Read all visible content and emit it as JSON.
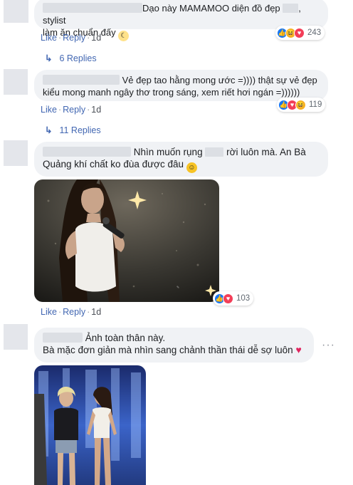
{
  "comments": [
    {
      "text_a": "Dạo này MAMAMOO diện đồ đẹp",
      "text_b": ", stylist",
      "text_c": "làm ăn chuẩn đấy",
      "emoji": "crescent-moon",
      "actions": {
        "like": "Like",
        "reply": "Reply",
        "time": "1d"
      },
      "reaction_count": "243",
      "replies": "6 Replies"
    },
    {
      "text_a": "Vẻ đẹp tao hằng mong ước =)))) thật sự vẻ đẹp",
      "text_b": "kiểu mong manh ngây thơ trong sáng, xem riết hơi ngán =))))))",
      "actions": {
        "like": "Like",
        "reply": "Reply",
        "time": "1d"
      },
      "reaction_count": "119",
      "replies": "11 Replies"
    },
    {
      "text_a": "Nhìn muốn rụng",
      "text_b": "rời luôn mà. An Bà",
      "text_c": "Quảng khí chất ko đùa được đâu",
      "emoji": "smiling-face",
      "actions": {
        "like": "Like",
        "reply": "Reply",
        "time": "1d"
      },
      "reaction_count": "103"
    },
    {
      "text_a": "Ảnh toàn thân này.",
      "text_b": "Bà mặc đơn giản mà nhìn sang chảnh thần thái dễ sợ luôn",
      "emoji": "red-heart"
    }
  ],
  "colors": {
    "link": "#4267b2",
    "bubble": "#f0f2f5",
    "like": "#1877f2",
    "love": "#f33e58",
    "haha": "#f7b125"
  }
}
